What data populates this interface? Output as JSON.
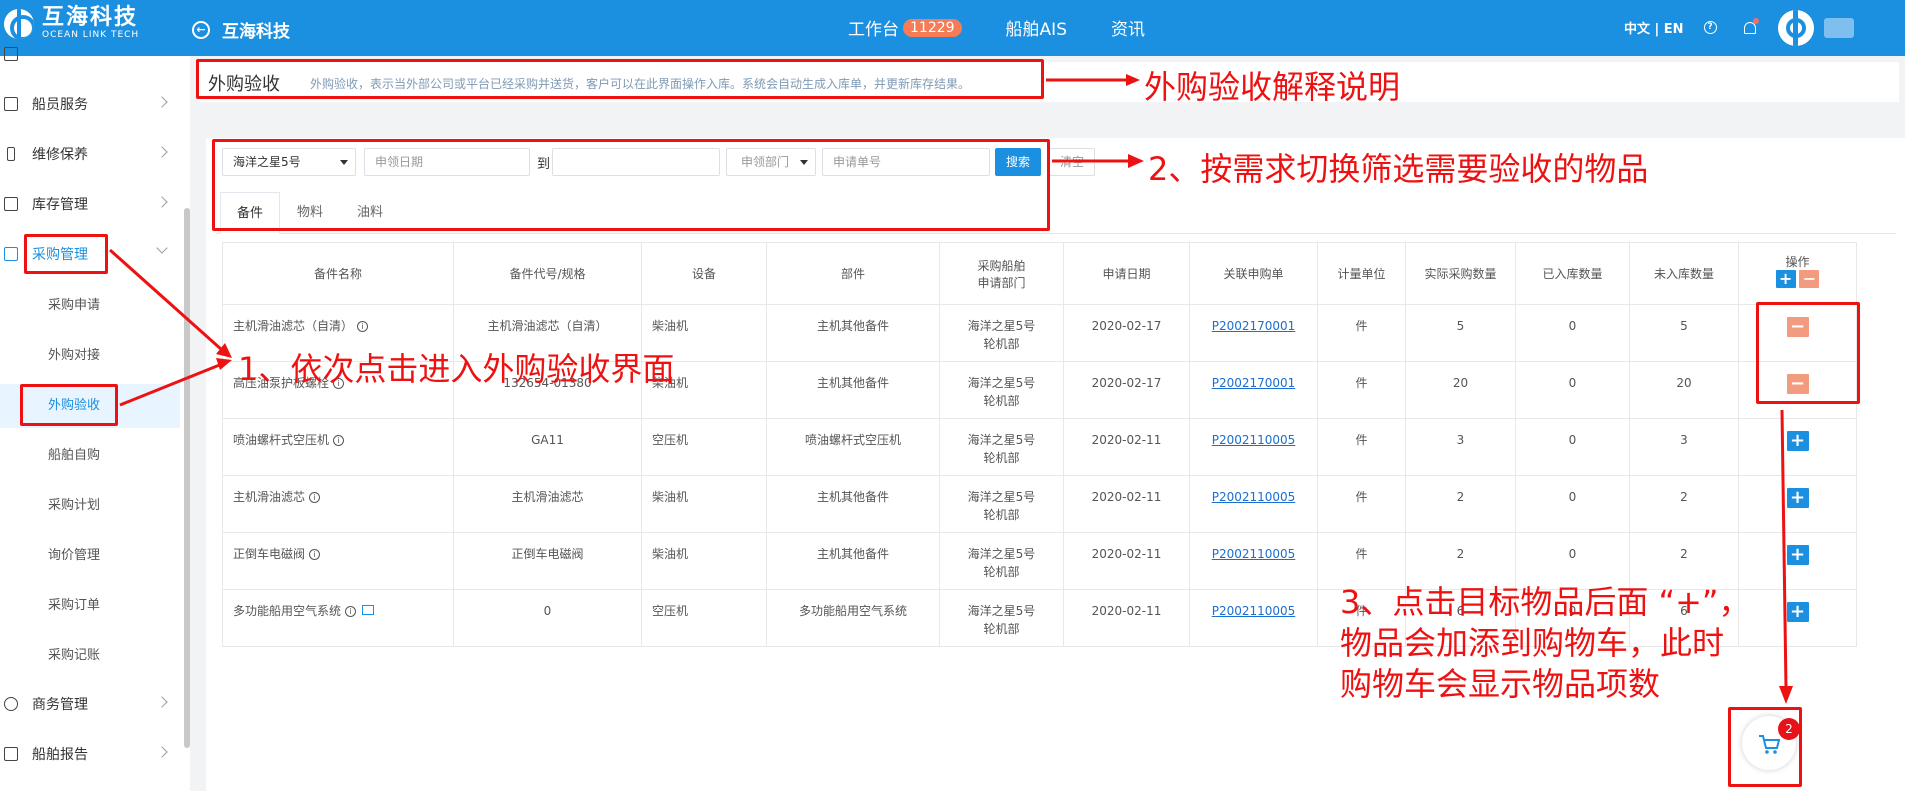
{
  "brand": {
    "name_cn": "互海科技",
    "name_en": "OCEAN LINK TECH"
  },
  "back_title": "互海科技",
  "topnav": {
    "workbench": "工作台",
    "workbench_count": "11229",
    "ais": "船舶AIS",
    "news": "资讯"
  },
  "lang": "中文 | EN",
  "sidebar": {
    "items": [
      {
        "label": "船员服务"
      },
      {
        "label": "维修保养"
      },
      {
        "label": "库存管理"
      },
      {
        "label": "采购管理"
      },
      {
        "label": "商务管理"
      },
      {
        "label": "船舶报告"
      }
    ],
    "sub_items": [
      "采购申请",
      "外购对接",
      "外购验收",
      "船舶自购",
      "采购计划",
      "询价管理",
      "采购订单",
      "采购记账"
    ]
  },
  "header": {
    "title": "外购验收",
    "desc": "外购验收，表示当外部公司或平台已经采购并送货，客户可以在此界面操作入库。系统会自动生成入库单，并更新库存结果。"
  },
  "filters": {
    "ship": "海洋之星5号",
    "apply_date_placeholder": "申领日期",
    "to": "到",
    "dept": "申领部门",
    "apply_no_placeholder": "申请单号",
    "search": "搜索",
    "clear": "清空"
  },
  "tabs": [
    "备件",
    "物料",
    "油料"
  ],
  "table": {
    "headers": [
      "备件名称",
      "备件代号/规格",
      "设备",
      "部件",
      "采购船舶\n申请部门",
      "申请日期",
      "关联申购单",
      "计量单位",
      "实际采购数量",
      "已入库数量",
      "未入库数量",
      "操作"
    ],
    "rows": [
      {
        "name": "主机滑油滤芯（自清）",
        "code": "主机滑油滤芯（自清）",
        "equip": "柴油机",
        "part": "主机其他备件",
        "ship": "海洋之星5号",
        "dept": "轮机部",
        "date": "2020-02-17",
        "order": "P2002170001",
        "unit": "件",
        "qty": "5",
        "in": "0",
        "notin": "5",
        "op": "−"
      },
      {
        "name": "高压油泵护板螺栓",
        "code": "132654-01380",
        "equip": "柴油机",
        "part": "主机其他备件",
        "ship": "海洋之星5号",
        "dept": "轮机部",
        "date": "2020-02-17",
        "order": "P2002170001",
        "unit": "件",
        "qty": "20",
        "in": "0",
        "notin": "20",
        "op": "−"
      },
      {
        "name": "喷油螺杆式空压机",
        "code": "GA11",
        "equip": "空压机",
        "part": "喷油螺杆式空压机",
        "ship": "海洋之星5号",
        "dept": "轮机部",
        "date": "2020-02-11",
        "order": "P2002110005",
        "unit": "件",
        "qty": "3",
        "in": "0",
        "notin": "3",
        "op": "+"
      },
      {
        "name": "主机滑油滤芯",
        "code": "主机滑油滤芯",
        "equip": "柴油机",
        "part": "主机其他备件",
        "ship": "海洋之星5号",
        "dept": "轮机部",
        "date": "2020-02-11",
        "order": "P2002110005",
        "unit": "件",
        "qty": "2",
        "in": "0",
        "notin": "2",
        "op": "+"
      },
      {
        "name": "正倒车电磁阀",
        "code": "正倒车电磁阀",
        "equip": "柴油机",
        "part": "主机其他备件",
        "ship": "海洋之星5号",
        "dept": "轮机部",
        "date": "2020-02-11",
        "order": "P2002110005",
        "unit": "件",
        "qty": "2",
        "in": "0",
        "notin": "2",
        "op": "+"
      },
      {
        "name": "多功能船用空气系统",
        "code": "0",
        "equip": "空压机",
        "part": "多功能船用空气系统",
        "ship": "海洋之星5号",
        "dept": "轮机部",
        "date": "2020-02-11",
        "order": "P2002110005",
        "unit": "件",
        "qty": "6",
        "in": "0",
        "notin": "6",
        "op": "+"
      }
    ]
  },
  "cart_count": "2",
  "annotations": {
    "a0": "外购验收解释说明",
    "a1": "1、依次点击进入外购验收界面",
    "a2": "2、按需求切换筛选需要验收的物品",
    "a3_line1": "3、点击目标物品后面 “+”，",
    "a3_line2": "物品会加添到购物车，此时",
    "a3_line3": "购物车会显示物品项数"
  },
  "colors": {
    "primary": "#1b8fe0",
    "annotation_red": "#ee1111",
    "minus_btn": "#f29b7e"
  }
}
